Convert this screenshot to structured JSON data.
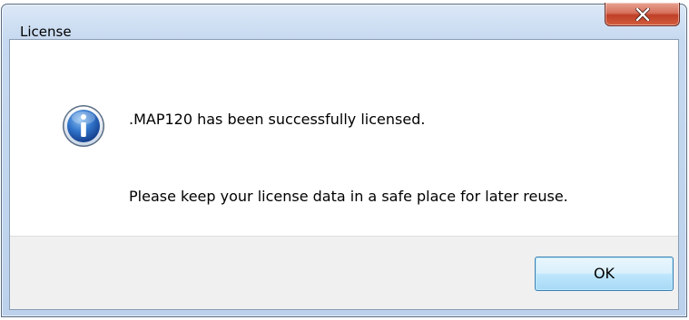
{
  "window": {
    "title": "License"
  },
  "titlebar": {
    "close_icon": "close-x-icon",
    "close_color": "#c7432b"
  },
  "message": {
    "icon": "information-icon",
    "line1": ".MAP120 has been successfully licensed.",
    "line2": "Please keep your license data in a safe place for later reuse."
  },
  "buttons": {
    "ok_label": "OK"
  }
}
